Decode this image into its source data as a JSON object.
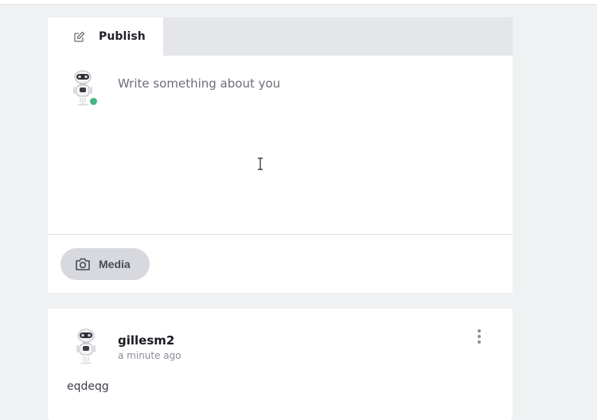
{
  "composer": {
    "tab_publish_label": "Publish",
    "textarea_placeholder": "Write something about you",
    "media_button_label": "Media",
    "user_status": "online",
    "status_color": "#43b581"
  },
  "post": {
    "author": "gillesm2",
    "time": "a minute ago",
    "body": "eqdeqg"
  },
  "icons": {
    "publish_tab": "edit-icon",
    "media_button": "camera-icon",
    "post_menu": "more-vertical-icon",
    "avatar": "robot-avatar"
  }
}
